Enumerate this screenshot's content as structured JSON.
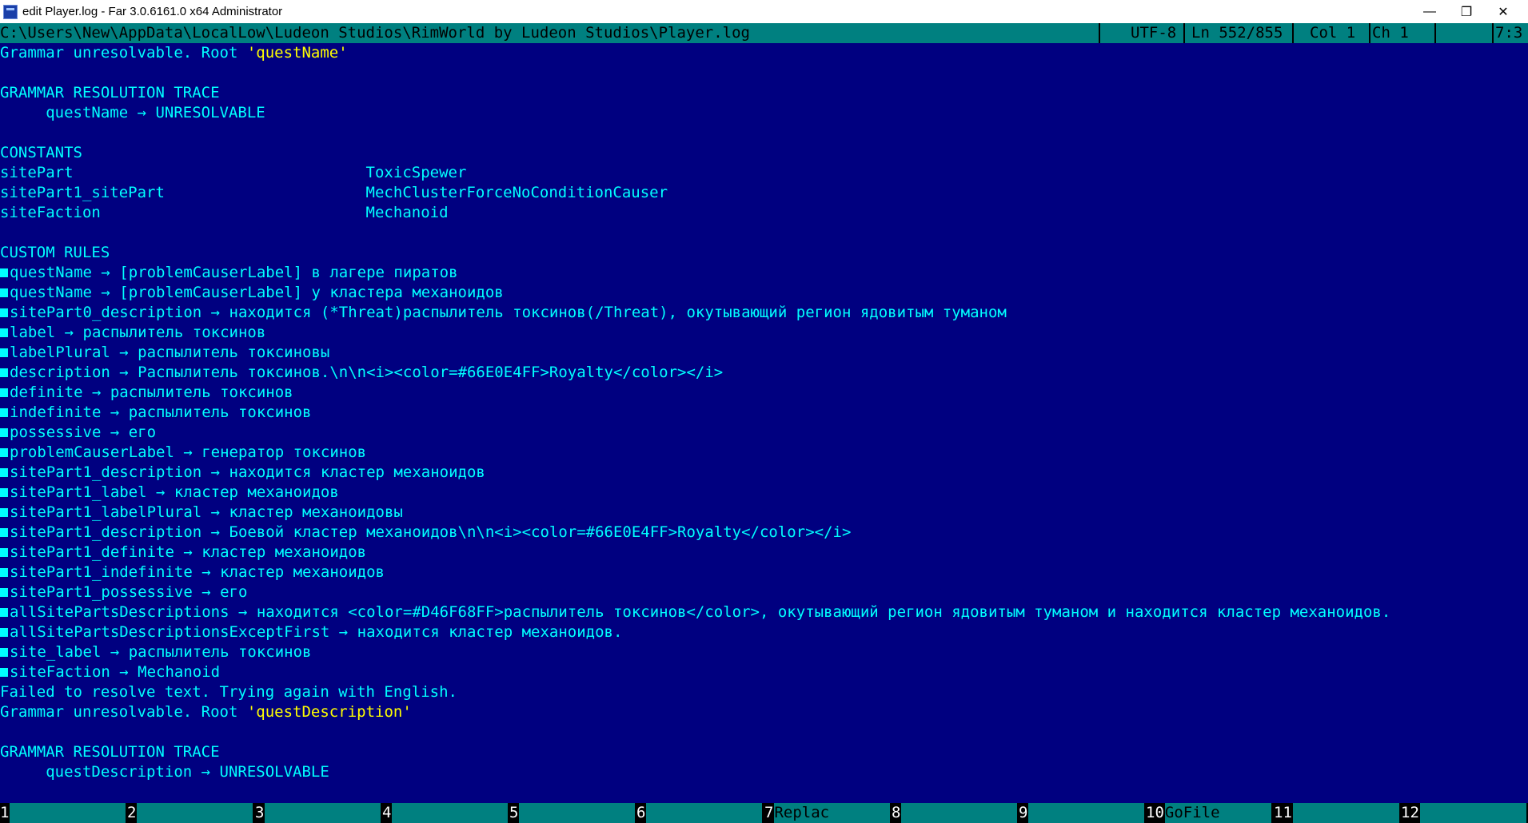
{
  "window": {
    "title": "edit Player.log - Far 3.0.6161.0 x64 Administrator",
    "minimize": "—",
    "maximize": "❐",
    "close": "✕"
  },
  "status": {
    "path": "C:\\Users\\New\\AppData\\LocalLow\\Ludeon Studios\\RimWorld by Ludeon Studios\\Player.log",
    "encoding": "UTF-8",
    "line": "Ln 552/855",
    "col": "Col 1",
    "ch": "Ch 1",
    "time": "7:3"
  },
  "lines": [
    {
      "t": "Grammar unresolvable. Root ",
      "y": "'questName'"
    },
    {
      "t": ""
    },
    {
      "t": "GRAMMAR RESOLUTION TRACE"
    },
    {
      "t": "     questName → UNRESOLVABLE"
    },
    {
      "t": ""
    },
    {
      "t": "CONSTANTS"
    },
    {
      "t": "sitePart                                ToxicSpewer"
    },
    {
      "t": "sitePart1_sitePart                      MechClusterForceNoConditionCauser"
    },
    {
      "t": "siteFaction                             Mechanoid"
    },
    {
      "t": ""
    },
    {
      "t": "CUSTOM RULES"
    },
    {
      "m": true,
      "t": "questName → [problemCauserLabel] в лагере пиратов"
    },
    {
      "m": true,
      "t": "questName → [problemCauserLabel] у кластера механоидов"
    },
    {
      "m": true,
      "t": "sitePart0_description → находится (*Threat)распылитель токсинов(/Threat), окутывающий регион ядовитым туманом"
    },
    {
      "m": true,
      "t": "label → распылитель токсинов"
    },
    {
      "m": true,
      "t": "labelPlural → распылитель токсиновы"
    },
    {
      "m": true,
      "t": "description → Распылитель токсинов.\\n\\n<i><color=#66E0E4FF>Royalty</color></i>"
    },
    {
      "m": true,
      "t": "definite → распылитель токсинов"
    },
    {
      "m": true,
      "t": "indefinite → распылитель токсинов"
    },
    {
      "m": true,
      "t": "possessive → его"
    },
    {
      "m": true,
      "t": "problemCauserLabel → генератор токсинов"
    },
    {
      "m": true,
      "t": "sitePart1_description → находится кластер механоидов"
    },
    {
      "m": true,
      "t": "sitePart1_label → кластер механоидов"
    },
    {
      "m": true,
      "t": "sitePart1_labelPlural → кластер механоидовы"
    },
    {
      "m": true,
      "t": "sitePart1_description → Боевой кластер механоидов\\n\\n<i><color=#66E0E4FF>Royalty</color></i>"
    },
    {
      "m": true,
      "t": "sitePart1_definite → кластер механоидов"
    },
    {
      "m": true,
      "t": "sitePart1_indefinite → кластер механоидов"
    },
    {
      "m": true,
      "t": "sitePart1_possessive → его"
    },
    {
      "m": true,
      "t": "allSitePartsDescriptions → находится <color=#D46F68FF>распылитель токсинов</color>, окутывающий регион ядовитым туманом и находится кластер механоидов."
    },
    {
      "m": true,
      "t": "allSitePartsDescriptionsExceptFirst → находится кластер механоидов."
    },
    {
      "m": true,
      "t": "site_label → распылитель токсинов"
    },
    {
      "m": true,
      "t": "siteFaction → Mechanoid"
    },
    {
      "t": "Failed to resolve text. Trying again with English."
    },
    {
      "t": "Grammar unresolvable. Root ",
      "y": "'questDescription'"
    },
    {
      "t": ""
    },
    {
      "t": "GRAMMAR RESOLUTION TRACE"
    },
    {
      "t": "     questDescription → UNRESOLVABLE"
    }
  ],
  "keybar": [
    {
      "num": "1",
      "label": ""
    },
    {
      "num": "2",
      "label": ""
    },
    {
      "num": "3",
      "label": ""
    },
    {
      "num": "4",
      "label": ""
    },
    {
      "num": "5",
      "label": ""
    },
    {
      "num": "6",
      "label": ""
    },
    {
      "num": "7",
      "label": "Replac"
    },
    {
      "num": "8",
      "label": ""
    },
    {
      "num": "9",
      "label": ""
    },
    {
      "num": "10",
      "label": "GoFile"
    },
    {
      "num": "11",
      "label": ""
    },
    {
      "num": "12",
      "label": ""
    }
  ],
  "colors": {
    "background": "#000080",
    "text": "#00ffff",
    "highlight": "#ffff00",
    "bar": "#008080"
  }
}
